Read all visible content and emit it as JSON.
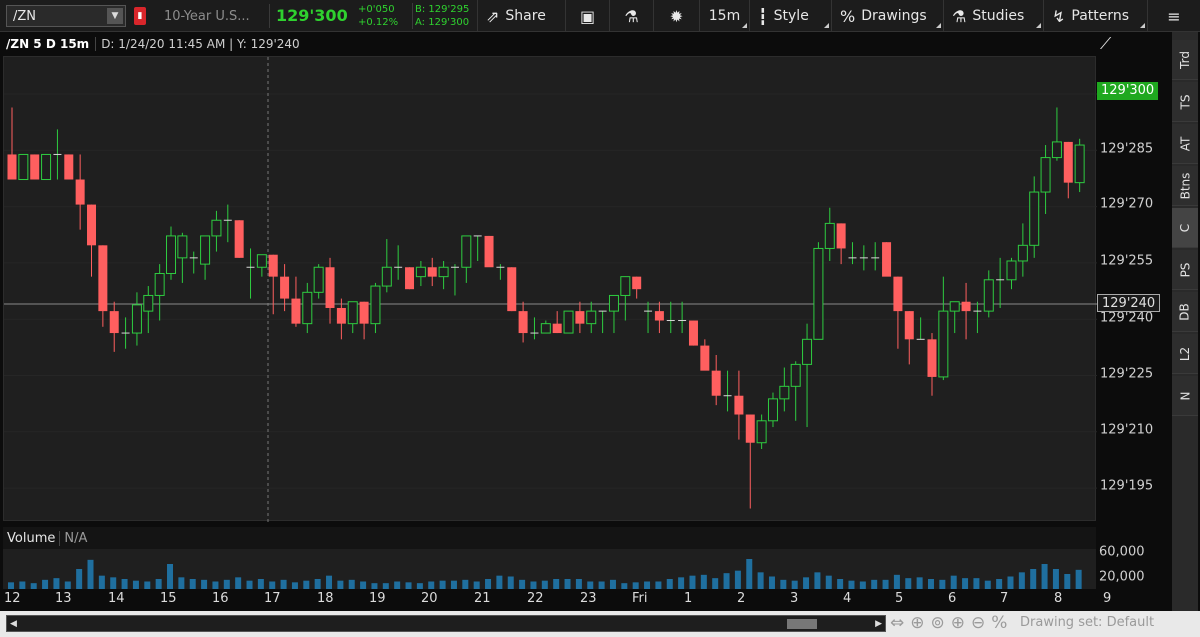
{
  "toolbar": {
    "symbol": "/ZN",
    "description": "10-Year U.S...",
    "last": "129'300",
    "change": "+0'050",
    "change_pct": "+0.12%",
    "bid": "B: 129'295",
    "ask": "A: 129'300",
    "share": "Share",
    "interval": "15m",
    "style": "Style",
    "drawings": "Drawings",
    "studies": "Studies",
    "patterns": "Patterns"
  },
  "chart_header": {
    "symbol": "/ZN 5 D 15m",
    "info": "D: 1/24/20 11:45 AM  |  Y: 129'240"
  },
  "price_axis": {
    "ticks": [
      "129'285",
      "129'270",
      "129'255",
      "129'240",
      "129'225",
      "129'210",
      "129'195"
    ],
    "last_label": "129'300",
    "cross_label": "129'240"
  },
  "volume": {
    "title": "Volume",
    "value": "N/A",
    "ticks": [
      "60,000",
      "20,000"
    ]
  },
  "x_axis": {
    "labels": [
      "12",
      "13",
      "14",
      "15",
      "16",
      "17",
      "18",
      "19",
      "20",
      "21",
      "22",
      "23",
      "Fri",
      "1",
      "2",
      "3",
      "4",
      "5",
      "6",
      "7",
      "8",
      "9"
    ]
  },
  "side_tabs": [
    "Trd",
    "TS",
    "AT",
    "Btns",
    "C",
    "PS",
    "DB",
    "L2",
    "N"
  ],
  "bottom": {
    "drawing_set": "Drawing set: Default"
  },
  "colors": {
    "up": "#2ecc40",
    "down": "#ff5f5f",
    "last_label_bg": "#1fa81f",
    "volume_bar": "#1f6f9f"
  },
  "chart_data": {
    "type": "candlestick",
    "ylim": [
      129.1797,
      129.3281
    ],
    "ohlc": [
      [
        129.297,
        129.312,
        129.289,
        129.289
      ],
      [
        129.289,
        129.297,
        129.289,
        129.297
      ],
      [
        129.297,
        129.297,
        129.289,
        129.289
      ],
      [
        129.289,
        129.297,
        129.289,
        129.297
      ],
      [
        129.297,
        129.305,
        129.289,
        129.297
      ],
      [
        129.297,
        129.297,
        129.289,
        129.289
      ],
      [
        129.289,
        129.297,
        129.273,
        129.281
      ],
      [
        129.281,
        129.281,
        129.258,
        129.268
      ],
      [
        129.268,
        129.268,
        129.242,
        129.247
      ],
      [
        129.247,
        129.25,
        129.234,
        129.24
      ],
      [
        129.24,
        129.245,
        129.235,
        129.24
      ],
      [
        129.24,
        129.253,
        129.236,
        129.249
      ],
      [
        129.247,
        129.255,
        129.24,
        129.252
      ],
      [
        129.252,
        129.262,
        129.244,
        129.259
      ],
      [
        129.259,
        129.274,
        129.257,
        129.271
      ],
      [
        129.264,
        129.272,
        129.256,
        129.271
      ],
      [
        129.264,
        129.266,
        129.259,
        129.264
      ],
      [
        129.262,
        129.271,
        129.257,
        129.271
      ],
      [
        129.271,
        129.279,
        129.266,
        129.276
      ],
      [
        129.276,
        129.281,
        129.269,
        129.276
      ],
      [
        129.276,
        129.276,
        129.264,
        129.264
      ],
      [
        129.261,
        129.267,
        129.251,
        129.261
      ],
      [
        129.261,
        129.265,
        129.258,
        129.265
      ],
      [
        129.265,
        129.265,
        129.246,
        129.258
      ],
      [
        129.258,
        129.262,
        129.247,
        129.251
      ],
      [
        129.251,
        129.258,
        129.242,
        129.243
      ],
      [
        129.243,
        129.256,
        129.24,
        129.253
      ],
      [
        129.253,
        129.262,
        129.251,
        129.261
      ],
      [
        129.261,
        129.264,
        129.243,
        129.248
      ],
      [
        129.248,
        129.251,
        129.238,
        129.243
      ],
      [
        129.243,
        129.25,
        129.24,
        129.25
      ],
      [
        129.25,
        129.25,
        129.238,
        129.243
      ],
      [
        129.243,
        129.256,
        129.24,
        129.255
      ],
      [
        129.255,
        129.27,
        129.253,
        129.261
      ],
      [
        129.261,
        129.268,
        129.257,
        129.261
      ],
      [
        129.261,
        129.261,
        129.254,
        129.254
      ],
      [
        129.258,
        129.263,
        129.255,
        129.261
      ],
      [
        129.261,
        129.264,
        129.255,
        129.258
      ],
      [
        129.258,
        129.263,
        129.254,
        129.261
      ],
      [
        129.261,
        129.262,
        129.252,
        129.261
      ],
      [
        129.261,
        129.271,
        129.256,
        129.271
      ],
      [
        129.271,
        129.271,
        129.263,
        129.271
      ],
      [
        129.271,
        129.271,
        129.262,
        129.261
      ],
      [
        129.261,
        129.262,
        129.257,
        129.261
      ],
      [
        129.261,
        129.261,
        129.247,
        129.247
      ],
      [
        129.247,
        129.25,
        129.237,
        129.24
      ],
      [
        129.24,
        129.245,
        129.238,
        129.24
      ],
      [
        129.24,
        129.244,
        129.24,
        129.243
      ],
      [
        129.243,
        129.247,
        129.24,
        129.24
      ],
      [
        129.24,
        129.247,
        129.24,
        129.247
      ],
      [
        129.247,
        129.25,
        129.24,
        129.243
      ],
      [
        129.243,
        129.25,
        129.24,
        129.247
      ],
      [
        129.247,
        129.247,
        129.24,
        129.247
      ],
      [
        129.247,
        129.252,
        129.24,
        129.252
      ],
      [
        129.252,
        129.258,
        129.244,
        129.258
      ],
      [
        129.258,
        129.258,
        129.251,
        129.254
      ],
      [
        129.247,
        129.25,
        129.24,
        129.247
      ],
      [
        129.247,
        129.25,
        129.24,
        129.244
      ],
      [
        129.244,
        129.25,
        129.24,
        129.244
      ],
      [
        129.244,
        129.25,
        129.24,
        129.244
      ],
      [
        129.244,
        129.244,
        129.236,
        129.236
      ],
      [
        129.236,
        129.238,
        129.231,
        129.228
      ],
      [
        129.228,
        129.233,
        129.217,
        129.22
      ],
      [
        129.22,
        129.228,
        129.215,
        129.22
      ],
      [
        129.22,
        129.228,
        129.206,
        129.214
      ],
      [
        129.214,
        129.214,
        129.184,
        129.205
      ],
      [
        129.205,
        129.214,
        129.203,
        129.212
      ],
      [
        129.212,
        129.221,
        129.21,
        129.219
      ],
      [
        129.219,
        129.229,
        129.215,
        129.223
      ],
      [
        129.223,
        129.231,
        129.212,
        129.23
      ],
      [
        129.23,
        129.243,
        129.21,
        129.238
      ],
      [
        129.238,
        129.269,
        129.238,
        129.267
      ],
      [
        129.267,
        129.28,
        129.263,
        129.275
      ],
      [
        129.275,
        129.275,
        129.262,
        129.267
      ],
      [
        129.264,
        129.269,
        129.262,
        129.264
      ],
      [
        129.264,
        129.268,
        129.26,
        129.264
      ],
      [
        129.264,
        129.269,
        129.26,
        129.264
      ],
      [
        129.269,
        129.269,
        129.259,
        129.258
      ],
      [
        129.258,
        129.258,
        129.235,
        129.247
      ],
      [
        129.247,
        129.247,
        129.23,
        129.238
      ],
      [
        129.238,
        129.245,
        129.238,
        129.238
      ],
      [
        129.238,
        129.24,
        129.22,
        129.226
      ],
      [
        129.226,
        129.258,
        129.225,
        129.247
      ],
      [
        129.247,
        129.25,
        129.24,
        129.25
      ],
      [
        129.25,
        129.256,
        129.238,
        129.247
      ],
      [
        129.247,
        129.25,
        129.24,
        129.247
      ],
      [
        129.247,
        129.26,
        129.245,
        129.257
      ],
      [
        129.257,
        129.264,
        129.248,
        129.257
      ],
      [
        129.257,
        129.264,
        129.254,
        129.263
      ],
      [
        129.263,
        129.275,
        129.258,
        129.268
      ],
      [
        129.268,
        129.29,
        129.264,
        129.285
      ],
      [
        129.285,
        129.3,
        129.278,
        129.296
      ],
      [
        129.296,
        129.312,
        129.295,
        129.301
      ],
      [
        129.301,
        129.301,
        129.283,
        129.288
      ],
      [
        129.288,
        129.302,
        129.285,
        129.3
      ]
    ],
    "volume": [
      8,
      9,
      7,
      11,
      13,
      9,
      24,
      35,
      16,
      14,
      12,
      10,
      9,
      12,
      30,
      14,
      12,
      11,
      9,
      11,
      14,
      10,
      12,
      9,
      11,
      8,
      10,
      12,
      16,
      10,
      11,
      9,
      7,
      7,
      9,
      8,
      7,
      9,
      10,
      10,
      11,
      9,
      12,
      16,
      15,
      11,
      9,
      10,
      12,
      12,
      12,
      9,
      9,
      11,
      7,
      8,
      9,
      9,
      12,
      14,
      16,
      17,
      13,
      19,
      22,
      36,
      20,
      15,
      11,
      10,
      14,
      20,
      16,
      12,
      10,
      9,
      11,
      11,
      17,
      13,
      14,
      12,
      11,
      16,
      13,
      13,
      10,
      12,
      15,
      20,
      24,
      30,
      24,
      18,
      23
    ]
  }
}
